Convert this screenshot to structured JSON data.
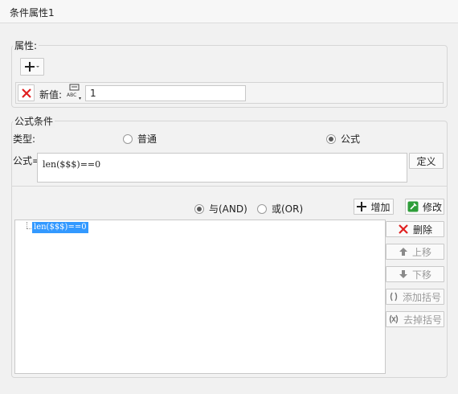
{
  "window": {
    "title": "条件属性1"
  },
  "attr_group": {
    "legend": "属性:",
    "new_value_label": "新值:",
    "new_value": "1"
  },
  "formula_group": {
    "legend": "公式条件",
    "type_label": "类型:",
    "type_options": [
      "普通",
      "公式"
    ],
    "type_selected": "公式",
    "formula_label": "公式=",
    "formula_value": "len($$$)==0",
    "define_button": "定义",
    "logic_options": [
      "与(AND)",
      "或(OR)"
    ],
    "logic_selected": "与(AND)",
    "add_button": "增加",
    "modify_button": "修改",
    "conditions": [
      "len($$$)==0"
    ],
    "side_buttons": {
      "delete": "删除",
      "move_up": "上移",
      "move_down": "下移",
      "add_bracket": "添加括号",
      "remove_bracket": "去掉括号"
    }
  },
  "colors": {
    "selection": "#3399ff",
    "delete_red": "#e02020",
    "modify_green": "#2e9e3a"
  }
}
